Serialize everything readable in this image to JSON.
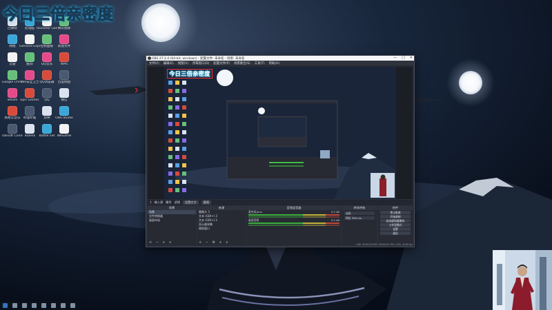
{
  "overlay": {
    "title": "今日三倍亲密度"
  },
  "obs": {
    "window_title": "OBS 27.2.4 (64-bit, windows) - 配置文件: 未命名 - 场景: 未命名",
    "menu": [
      "文件(F)",
      "编辑(E)",
      "视图(V)",
      "停靠窗口(D)",
      "配置文件(P)",
      "场景集合(S)",
      "工具(T)",
      "帮助(H)"
    ],
    "window_controls": [
      "—",
      "□",
      "✕"
    ],
    "preview_title": "今日三倍亲密度",
    "scene_bar": {
      "icon": "T",
      "label": "输入源",
      "props_label": "属性",
      "filters_label": "滤镜",
      "buttons": [
        "设置文字",
        "截图"
      ]
    },
    "scenes": {
      "header": "场景",
      "items": [
        "场景",
        "文件转换器",
        "画面布局"
      ],
      "selected": 0,
      "footer": "+ − ∧ ∨"
    },
    "sources": {
      "header": "来源",
      "items": [
        "摄像头 3",
        "文本 (GDI+) 3",
        "文本 (GDI+) 2",
        "显示器采集",
        "捕获窗口"
      ],
      "footer": "+ − ⚙ ∧ ∨"
    },
    "mixer": {
      "header": "音频混音器",
      "tracks": [
        {
          "name": "麦克风/Aux",
          "level": "0.0 dB"
        },
        {
          "name": "桌面音频",
          "level": "0.0 dB"
        }
      ]
    },
    "transitions": {
      "header": "转场特效",
      "type": "淡出",
      "duration_label": "时长",
      "duration": "300 ms"
    },
    "controls": {
      "header": "控件",
      "buttons": [
        "停止推流",
        "开始录制",
        "启动虚拟摄像机",
        "工作室模式",
        "设置",
        "退出"
      ]
    },
    "status": "LIVE: 00:00:00   REC: 00:00:00   CPU: 1.6%, 30.00 fps"
  },
  "desktop": {
    "icons": [
      "回收站",
      "此电脑",
      "Rockstar Games",
      "腾讯视频",
      "网络",
      "GeForce Experience",
      "控制面板",
      "新建文件",
      "迅雷",
      "酷狗",
      "QQ音乐",
      "WPS",
      "Google Chrome",
      "360安全卫士",
      "QQ浏览器",
      "百度网盘",
      "Steam",
      "Epic Games",
      "QQ",
      "微信",
      "网易云音乐",
      "哔哩哔哩",
      "剪映",
      "OBS Studio",
      "Ubisoft Connect",
      "ToDesk",
      "Battle.net",
      "WeGame"
    ]
  },
  "colors": {
    "accent_border": "#ff2a2a",
    "obs_dark": "#2b2e38",
    "title_glow": "#3ad0ff"
  }
}
